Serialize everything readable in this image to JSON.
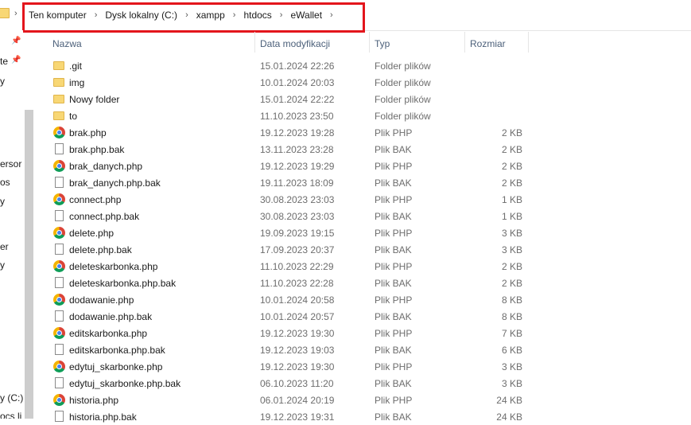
{
  "address_bar": {
    "breadcrumb": [
      "Ten komputer",
      "Dysk lokalny (C:)",
      "xampp",
      "htdocs",
      "eWallet"
    ],
    "separator": "›",
    "highlight_color": "#e3151c"
  },
  "nav_pane": {
    "visible_fragments": [
      "te",
      "y",
      "ersor",
      "os",
      "y",
      "er",
      "y",
      "y (C:)",
      "ocs li"
    ]
  },
  "columns": {
    "name": "Nazwa",
    "date": "Data modyfikacji",
    "type": "Typ",
    "size": "Rozmiar"
  },
  "files": [
    {
      "icon": "folder-icon",
      "name": ".git",
      "date": "15.01.2024 22:26",
      "type": "Folder plików",
      "size": ""
    },
    {
      "icon": "folder-icon",
      "name": "img",
      "date": "10.01.2024 20:03",
      "type": "Folder plików",
      "size": ""
    },
    {
      "icon": "folder-icon",
      "name": "Nowy folder",
      "date": "15.01.2024 22:22",
      "type": "Folder plików",
      "size": ""
    },
    {
      "icon": "folder-icon",
      "name": "to",
      "date": "11.10.2023 23:50",
      "type": "Folder plików",
      "size": ""
    },
    {
      "icon": "chrome-icon",
      "name": "brak.php",
      "date": "19.12.2023 19:28",
      "type": "Plik PHP",
      "size": "2 KB"
    },
    {
      "icon": "file-icon",
      "name": "brak.php.bak",
      "date": "13.11.2023 23:28",
      "type": "Plik BAK",
      "size": "2 KB"
    },
    {
      "icon": "chrome-icon",
      "name": "brak_danych.php",
      "date": "19.12.2023 19:29",
      "type": "Plik PHP",
      "size": "2 KB"
    },
    {
      "icon": "file-icon",
      "name": "brak_danych.php.bak",
      "date": "19.11.2023 18:09",
      "type": "Plik BAK",
      "size": "2 KB"
    },
    {
      "icon": "chrome-icon",
      "name": "connect.php",
      "date": "30.08.2023 23:03",
      "type": "Plik PHP",
      "size": "1 KB"
    },
    {
      "icon": "file-icon",
      "name": "connect.php.bak",
      "date": "30.08.2023 23:03",
      "type": "Plik BAK",
      "size": "1 KB"
    },
    {
      "icon": "chrome-icon",
      "name": "delete.php",
      "date": "19.09.2023 19:15",
      "type": "Plik PHP",
      "size": "3 KB"
    },
    {
      "icon": "file-icon",
      "name": "delete.php.bak",
      "date": "17.09.2023 20:37",
      "type": "Plik BAK",
      "size": "3 KB"
    },
    {
      "icon": "chrome-icon",
      "name": "deleteskarbonka.php",
      "date": "11.10.2023 22:29",
      "type": "Plik PHP",
      "size": "2 KB"
    },
    {
      "icon": "file-icon",
      "name": "deleteskarbonka.php.bak",
      "date": "11.10.2023 22:28",
      "type": "Plik BAK",
      "size": "2 KB"
    },
    {
      "icon": "chrome-icon",
      "name": "dodawanie.php",
      "date": "10.01.2024 20:58",
      "type": "Plik PHP",
      "size": "8 KB"
    },
    {
      "icon": "file-icon",
      "name": "dodawanie.php.bak",
      "date": "10.01.2024 20:57",
      "type": "Plik BAK",
      "size": "8 KB"
    },
    {
      "icon": "chrome-icon",
      "name": "editskarbonka.php",
      "date": "19.12.2023 19:30",
      "type": "Plik PHP",
      "size": "7 KB"
    },
    {
      "icon": "file-icon",
      "name": "editskarbonka.php.bak",
      "date": "19.12.2023 19:03",
      "type": "Plik BAK",
      "size": "6 KB"
    },
    {
      "icon": "chrome-icon",
      "name": "edytuj_skarbonke.php",
      "date": "19.12.2023 19:30",
      "type": "Plik PHP",
      "size": "3 KB"
    },
    {
      "icon": "file-icon",
      "name": "edytuj_skarbonke.php.bak",
      "date": "06.10.2023 11:20",
      "type": "Plik BAK",
      "size": "3 KB"
    },
    {
      "icon": "chrome-icon",
      "name": "historia.php",
      "date": "06.01.2024 20:19",
      "type": "Plik PHP",
      "size": "24 KB"
    },
    {
      "icon": "file-icon",
      "name": "historia.php.bak",
      "date": "19.12.2023 19:31",
      "type": "Plik BAK",
      "size": "24 KB"
    }
  ]
}
